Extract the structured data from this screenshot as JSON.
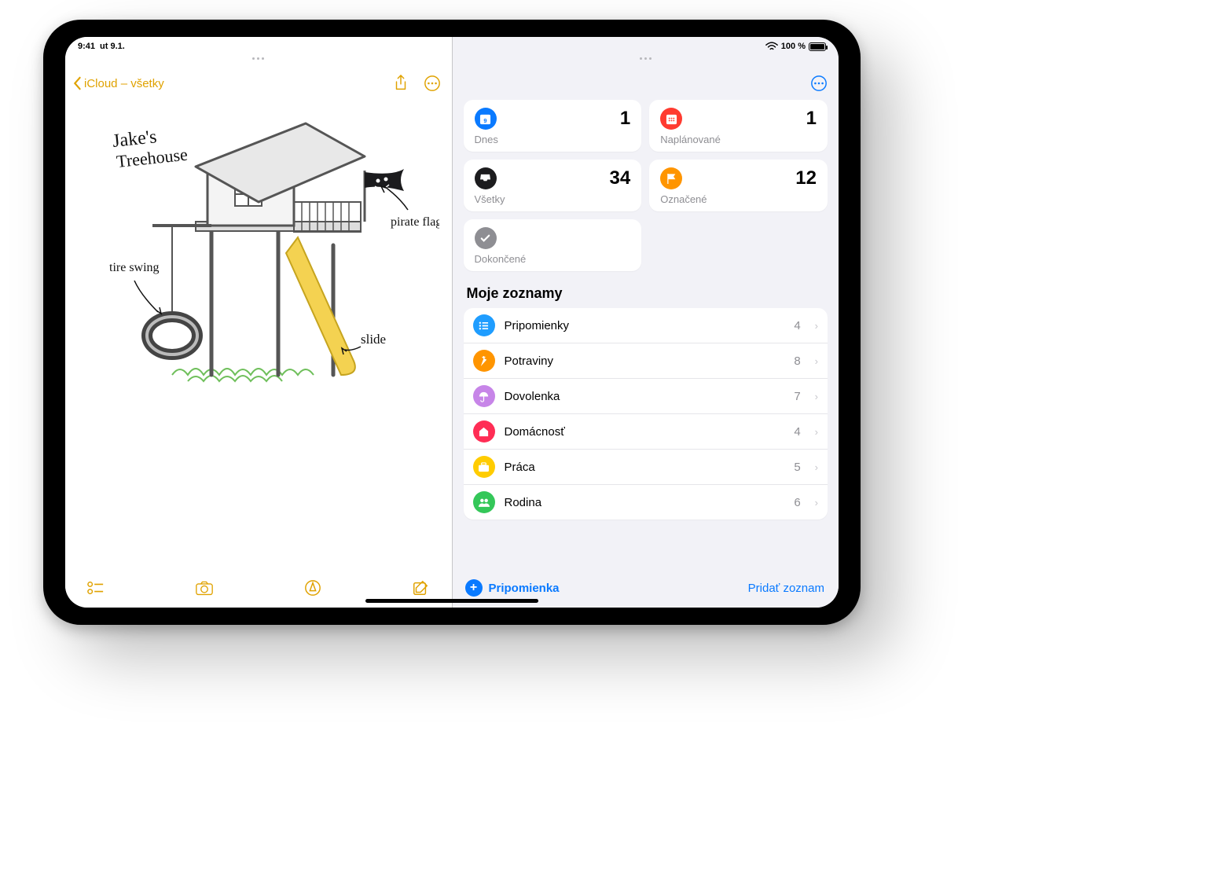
{
  "status": {
    "time": "9:41",
    "date": "ut 9.1.",
    "battery": "100 %"
  },
  "notes": {
    "back_label": "iCloud – všetky",
    "meta_line1": "",
    "meta_line2": "",
    "drawing": {
      "title": "Jake's Treehouse",
      "annotations": {
        "tire": "tire swing",
        "flag": "pirate flag",
        "slide": "slide"
      }
    }
  },
  "reminders": {
    "tiles": [
      {
        "label": "Dnes",
        "count": "1",
        "icon": "calendar-icon",
        "color": "c-blue"
      },
      {
        "label": "Naplánované",
        "count": "1",
        "icon": "calendar-grid-icon",
        "color": "c-red"
      },
      {
        "label": "Všetky",
        "count": "34",
        "icon": "inbox-icon",
        "color": "c-black"
      },
      {
        "label": "Označené",
        "count": "12",
        "icon": "flag-icon",
        "color": "c-orange"
      },
      {
        "label": "Dokončené",
        "count": "",
        "icon": "check-icon",
        "color": "c-grey"
      }
    ],
    "section_title": "Moje zoznamy",
    "lists": [
      {
        "name": "Pripomienky",
        "count": "4",
        "color": "c-bluel",
        "icon": "list-icon"
      },
      {
        "name": "Potraviny",
        "count": "8",
        "color": "c-orange",
        "icon": "carrot-icon"
      },
      {
        "name": "Dovolenka",
        "count": "7",
        "color": "c-purple",
        "icon": "umbrella-icon"
      },
      {
        "name": "Domácnosť",
        "count": "4",
        "color": "c-pink",
        "icon": "home-icon"
      },
      {
        "name": "Práca",
        "count": "5",
        "color": "c-yellow",
        "icon": "briefcase-icon"
      },
      {
        "name": "Rodina",
        "count": "6",
        "color": "c-green",
        "icon": "people-icon"
      }
    ],
    "new_reminder": "Pripomienka",
    "add_list": "Pridať zoznam"
  }
}
